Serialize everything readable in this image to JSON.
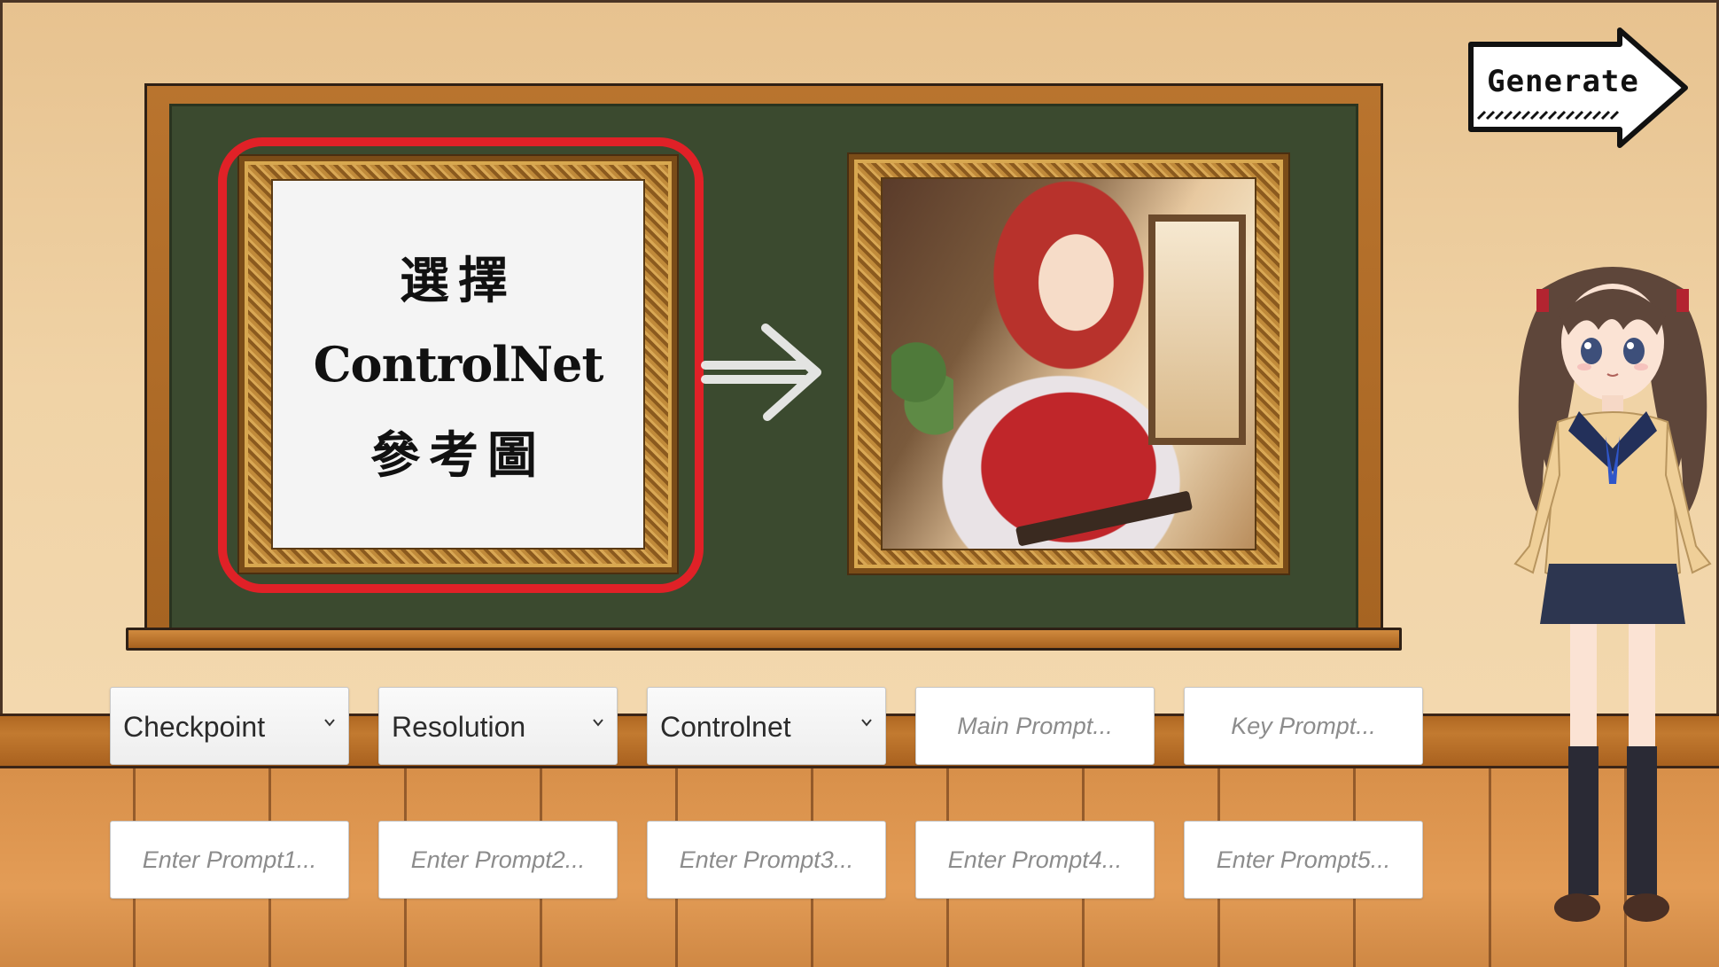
{
  "board": {
    "reference_text": {
      "line1": "選擇",
      "line2": "ControlNet",
      "line3": "參考圖"
    }
  },
  "generate_button": {
    "label": "Generate"
  },
  "controls": {
    "checkpoint": {
      "label": "Checkpoint"
    },
    "resolution": {
      "label": "Resolution"
    },
    "controlnet": {
      "label": "Controlnet"
    },
    "main_prompt": {
      "placeholder": "Main Prompt..."
    },
    "key_prompt": {
      "placeholder": "Key Prompt..."
    },
    "prompts": [
      {
        "placeholder": "Enter Prompt1..."
      },
      {
        "placeholder": "Enter Prompt2..."
      },
      {
        "placeholder": "Enter Prompt3..."
      },
      {
        "placeholder": "Enter Prompt4..."
      },
      {
        "placeholder": "Enter Prompt5..."
      }
    ]
  },
  "icons": {
    "arrow": "chalk-arrow-icon",
    "dropdown": "chevron-down-icon",
    "generate": "arrow-sign-icon"
  },
  "colors": {
    "highlight": "#e02127",
    "chalkboard": "#3b4a2f",
    "wall": "#eccb98",
    "wood": "#b06822"
  }
}
